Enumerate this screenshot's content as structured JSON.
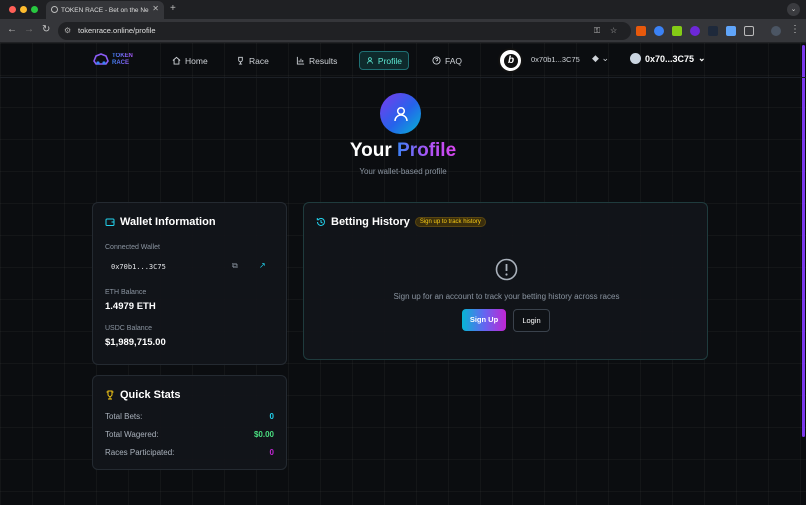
{
  "browser": {
    "tab_title": "TOKEN RACE - Bet on the Ne",
    "url": "tokenrace.online/profile"
  },
  "brand": {
    "line1": "TOKEN",
    "line2": "RACE"
  },
  "nav": {
    "items": [
      {
        "label": "Home",
        "icon": "home-icon"
      },
      {
        "label": "Race",
        "icon": "trophy-icon"
      },
      {
        "label": "Results",
        "icon": "bar-chart-icon"
      },
      {
        "label": "Profile",
        "icon": "user-icon",
        "active": true
      },
      {
        "label": "FAQ",
        "icon": "help-circle-icon"
      }
    ],
    "header_address": "0x70b1...3C75",
    "wallet_label": "0x70...3C75"
  },
  "hero": {
    "title_plain": "Your",
    "title_accent": "Profile",
    "subtitle": "Your wallet-based profile"
  },
  "wallet": {
    "title": "Wallet Information",
    "connected_label": "Connected Wallet",
    "connected_value": "0x70b1...3C75",
    "eth_label": "ETH Balance",
    "eth_value": "1.4979 ETH",
    "usdc_label": "USDC Balance",
    "usdc_value": "$1,989,715.00"
  },
  "stats": {
    "title": "Quick Stats",
    "rows": [
      {
        "label": "Total Bets:",
        "value": "0",
        "color": "#22d3ee"
      },
      {
        "label": "Total Wagered:",
        "value": "$0.00",
        "color": "#4ade80"
      },
      {
        "label": "Races Participated:",
        "value": "0",
        "color": "#c026d3"
      }
    ]
  },
  "history": {
    "title": "Betting History",
    "badge": "Sign up to track history",
    "message": "Sign up for an account to track your betting history across races",
    "signup_label": "Sign Up",
    "login_label": "Login"
  },
  "colors": {
    "accent": "#5eead4",
    "gradient_start": "#3b82f6",
    "gradient_end": "#a855f7"
  }
}
